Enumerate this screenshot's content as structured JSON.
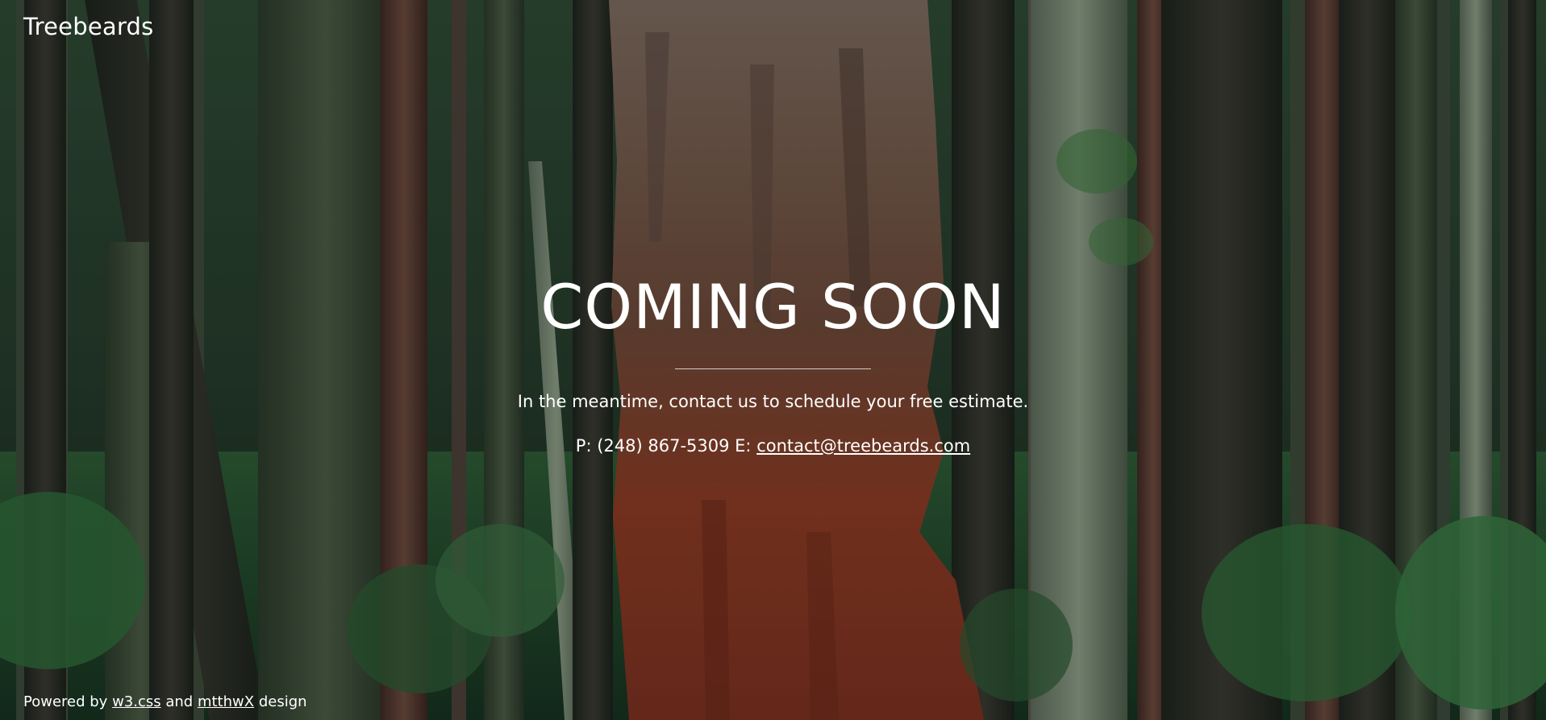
{
  "brand": {
    "name": "Treebeards"
  },
  "hero": {
    "headline": "COMING SOON",
    "subline": "In the meantime, contact us to schedule your free estimate.",
    "contact": {
      "phone_label": "P:",
      "phone": "(248) 867-5309",
      "email_label": "E:",
      "email": "contact@treebeards.com"
    }
  },
  "footer": {
    "prefix": "Powered by",
    "link1": "w3.css",
    "connector": "and",
    "link2": "mtthwX",
    "suffix": "design"
  },
  "colors": {
    "text": "#ffffff",
    "forest_dark": "#1b2a1e",
    "bark_red": "#8a3b24",
    "moss": "#3f6a3a"
  }
}
